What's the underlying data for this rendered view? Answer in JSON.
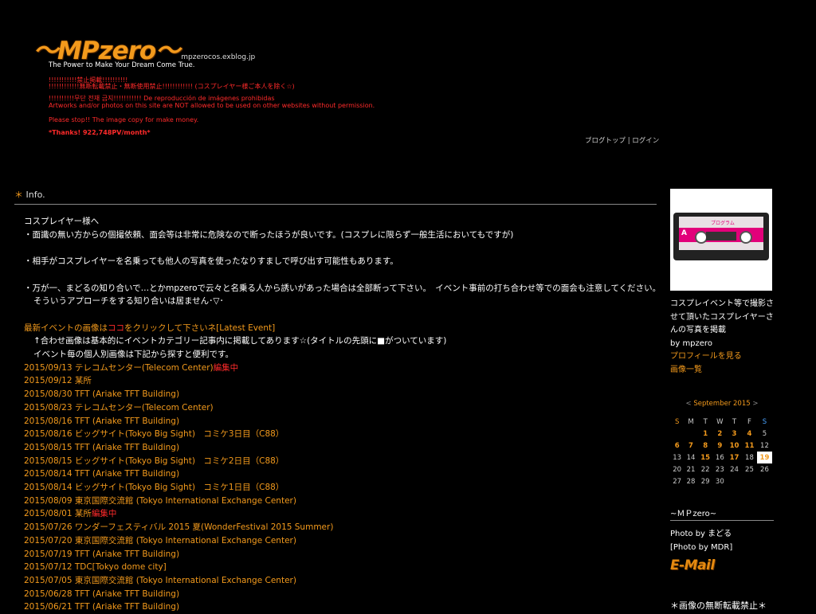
{
  "header": {
    "logo_text": "〜MPzero〜",
    "logo_url": "mpzerocos.exblog.jp",
    "tagline": "The Power to Make Your Dream Come True.",
    "warnings": [
      "!!!!!!!!!!!禁止掲載!!!!!!!!!!",
      "!!!!!!!!!!!!無断転載禁止・無断使用禁止!!!!!!!!!!!! (コスプレイヤー様ご本人を除く☆)",
      "!!!!!!!!!!무단 전재 금지!!!!!!!!!!! De reproducción de imágenes prohibidas",
      "Artworks and/or photos on this site are NOT allowed to be used on other websites without permission.",
      "Please stop!! The image copy for make money.",
      "*Thanks! 922,748PV/month*"
    ],
    "blog_top": "ブログトップ",
    "separator": "|",
    "login": "ログイン"
  },
  "main": {
    "section_star": "＊",
    "section_title": "Info.",
    "intro": [
      "コスプレイヤー様へ",
      "・面識の無い方からの個撮依頼、面会等は非常に危険なので断ったほうが良いです。(コスプレに限らず一般生活においてもですが)",
      "・相手がコスプレイヤーを名乗っても他人の写真を使ったなりすましで呼び出す可能性もあります。",
      "・万が一、まどるの知り合いで…とかmpzeroで云々と名乗る人から誘いがあった場合は全部断って下さい。　イベント事前の打ち合わせ等での面会も注意してください。",
      "そういうアプローチをする知り合いは居ません･▽･"
    ],
    "latest_pre": "最新イベントの画像は",
    "latest_link": "ココ",
    "latest_post": "をクリックして下さいネ[Latest Event]",
    "note1": "↑合わせ画像は基本的にイベントカテゴリー記事内に掲載してあります☆(タイトルの先頭に■がついています)",
    "note2": "イベント毎の個人別画像は下記から探すと便利です。",
    "events": [
      {
        "text": "2015/09/13 テレコムセンター(Telecom Center)",
        "tag": "編集中"
      },
      {
        "text": "2015/09/12 某所",
        "tag": ""
      },
      {
        "text": "2015/08/30 TFT (Ariake TFT Building)",
        "tag": ""
      },
      {
        "text": "2015/08/23 テレコムセンター(Telecom Center)",
        "tag": ""
      },
      {
        "text": "2015/08/16 TFT (Ariake TFT Building)",
        "tag": ""
      },
      {
        "text": "2015/08/16 ビッグサイト(Tokyo Big Sight)　コミケ3日目（C88）",
        "tag": ""
      },
      {
        "text": "2015/08/15 TFT (Ariake TFT Building)",
        "tag": ""
      },
      {
        "text": "2015/08/15 ビッグサイト(Tokyo Big Sight)　コミケ2日目（C88）",
        "tag": ""
      },
      {
        "text": "2015/08/14 TFT (Ariake TFT Building)",
        "tag": ""
      },
      {
        "text": "2015/08/14 ビッグサイト(Tokyo Big Sight)　コミケ1日目（C88）",
        "tag": ""
      },
      {
        "text": "2015/08/09 東京国際交流館 (Tokyo International Exchange Center)",
        "tag": ""
      },
      {
        "text": "2015/08/01 某所",
        "tag": "編集中"
      },
      {
        "text": "2015/07/26 ワンダーフェスティバル 2015 夏(WonderFestival 2015 Summer)",
        "tag": ""
      },
      {
        "text": "2015/07/20 東京国際交流館 (Tokyo International Exchange Center)",
        "tag": ""
      },
      {
        "text": "2015/07/19 TFT (Ariake TFT Building)",
        "tag": ""
      },
      {
        "text": "2015/07/12 TDC[Tokyo dome city]",
        "tag": ""
      },
      {
        "text": "2015/07/05 東京国際交流館 (Tokyo International Exchange Center)",
        "tag": ""
      },
      {
        "text": "2015/06/28 TFT (Ariake TFT Building)",
        "tag": ""
      },
      {
        "text": "2015/06/21 TFT (Ariake TFT Building)",
        "tag": ""
      }
    ]
  },
  "sidebar": {
    "image": {
      "a_label": "A",
      "title_label": "プログラム"
    },
    "description": "コスプレイベント等で撮影させて頂いたコスプレイヤーさんの写真を掲載",
    "by": "by mpzero",
    "profile_link": "プロフィールを見る",
    "image_list_link": "画像一覧",
    "calendar": {
      "prev": "<",
      "month": "September 2015",
      "next": ">",
      "weekdays": [
        "S",
        "M",
        "T",
        "W",
        "T",
        "F",
        "S"
      ],
      "weeks": [
        [
          "",
          "",
          "1",
          "2",
          "3",
          "4",
          "5"
        ],
        [
          "6",
          "7",
          "8",
          "9",
          "10",
          "11",
          "12"
        ],
        [
          "13",
          "14",
          "15",
          "16",
          "17",
          "18",
          "19"
        ],
        [
          "20",
          "21",
          "22",
          "23",
          "24",
          "25",
          "26"
        ],
        [
          "27",
          "28",
          "29",
          "30",
          "",
          "",
          ""
        ]
      ],
      "linked_days": [
        "1",
        "2",
        "3",
        "4",
        "6",
        "7",
        "8",
        "9",
        "10",
        "11",
        "15",
        "17"
      ],
      "today": "19"
    },
    "mp_head": "~ＭＰzero~",
    "photo_by1": "Photo by まどる",
    "photo_by2": "[Photo by MDR]",
    "email": "E-Mail",
    "footer": "＊画像の無断転載禁止＊"
  },
  "colors": {
    "accent": "#f39a1c",
    "alert": "#ff2a2a",
    "saturday": "#4aa3ff",
    "background": "#000000"
  }
}
